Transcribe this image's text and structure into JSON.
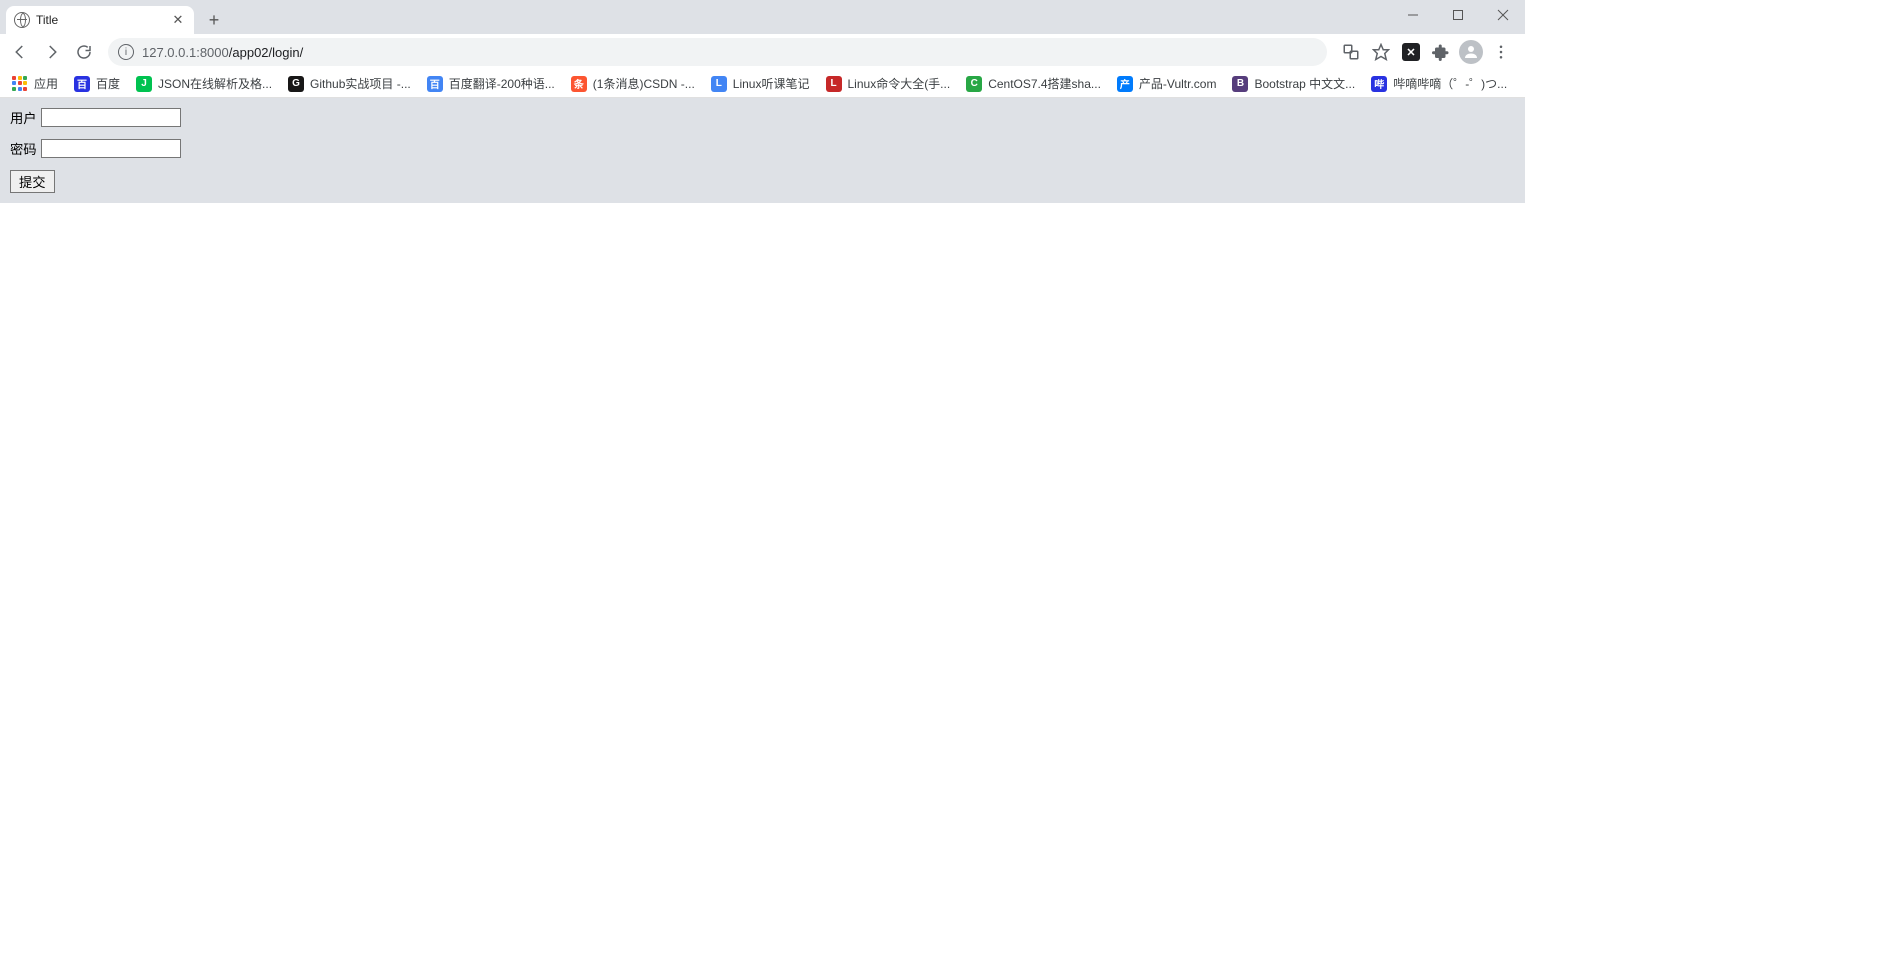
{
  "window": {
    "tab_title": "Title",
    "url_host": "127.0.0.1",
    "url_port": ":8000",
    "url_path": "/app02/login/"
  },
  "bookmarks": [
    {
      "label": "应用",
      "icon": "apps-grid"
    },
    {
      "label": "百度",
      "icon": "baidu-paw",
      "bg": "#2932e1"
    },
    {
      "label": "JSON在线解析及格...",
      "icon": "json-badge",
      "bg": "#00c250"
    },
    {
      "label": "Github实战项目 -...",
      "icon": "github-icon",
      "bg": "#181717"
    },
    {
      "label": "百度翻译-200种语...",
      "icon": "translate-icon",
      "bg": "#4285f4"
    },
    {
      "label": "(1条消息)CSDN -...",
      "icon": "csdn-icon",
      "bg": "#fc5531"
    },
    {
      "label": "Linux听课笔记",
      "icon": "doc-icon",
      "bg": "#4285f4"
    },
    {
      "label": "Linux命令大全(手...",
      "icon": "linux-icon",
      "bg": "#c62828"
    },
    {
      "label": "CentOS7.4搭建sha...",
      "icon": "centos-icon",
      "bg": "#28a745"
    },
    {
      "label": "产品-Vultr.com",
      "icon": "vultr-icon",
      "bg": "#007bfc"
    },
    {
      "label": "Bootstrap 中文文...",
      "icon": "bootstrap-icon",
      "bg": "#563d7c"
    },
    {
      "label": "哔嘀哔嘀（゜-゜)つ...",
      "icon": "bilibili-icon",
      "bg": "#2932e1"
    }
  ],
  "form": {
    "user_label": "用户",
    "password_label": "密码",
    "user_value": "",
    "password_value": "",
    "submit_label": "提交"
  }
}
